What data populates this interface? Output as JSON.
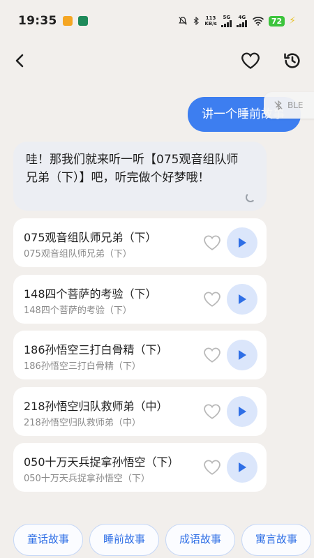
{
  "status_bar": {
    "time": "19:35",
    "net_speed_value": "113",
    "net_speed_unit": "KB/s",
    "signal_1": "5G",
    "signal_2": "4G",
    "battery": "72"
  },
  "nav": {
    "back_icon": "chevron-left-icon",
    "favorite_icon": "heart-icon",
    "history_icon": "history-icon"
  },
  "chat": {
    "user_message": "讲一个睡前故事",
    "ble_label": "BLE",
    "assistant_message": "哇！那我们就来听一听【075观音组队师兄弟（下）】吧，听完做个好梦哦！"
  },
  "stories": [
    {
      "title": "075观音组队师兄弟（下）",
      "subtitle": "075观音组队师兄弟（下）"
    },
    {
      "title": "148四个菩萨的考验（下）",
      "subtitle": "148四个菩萨的考验（下）"
    },
    {
      "title": "186孙悟空三打白骨精（下）",
      "subtitle": "186孙悟空三打白骨精（下）"
    },
    {
      "title": "218孙悟空归队救师弟（中）",
      "subtitle": "218孙悟空归队救师弟（中）"
    },
    {
      "title": "050十万天兵捉拿孙悟空（下）",
      "subtitle": "050十万天兵捉拿孙悟空（下）"
    }
  ],
  "categories": [
    "童话故事",
    "睡前故事",
    "成语故事",
    "寓言故事"
  ],
  "colors": {
    "accent": "#3d7ef0",
    "background": "#f2efec",
    "play_button_bg": "#dbe6fb",
    "battery": "#3cc43c"
  }
}
